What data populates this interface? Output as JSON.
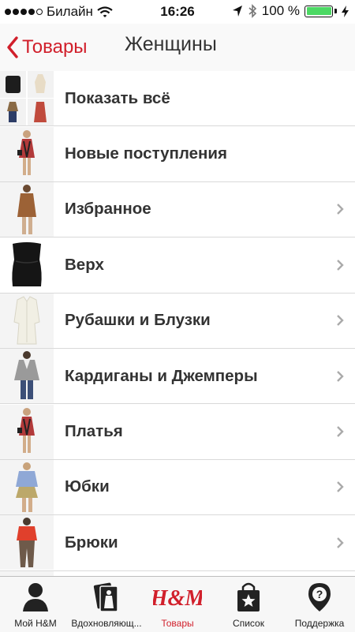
{
  "status_bar": {
    "carrier": "Билайн",
    "time": "16:26",
    "battery_text": "100 %"
  },
  "nav": {
    "back_label": "Товары",
    "title": "Женщины"
  },
  "list": [
    {
      "label": "Показать всё",
      "has_chevron": false,
      "thumb": "collage"
    },
    {
      "label": "Новые поступления",
      "has_chevron": false,
      "thumb": "dress-pattern"
    },
    {
      "label": "Избранное",
      "has_chevron": true,
      "thumb": "brown-top"
    },
    {
      "label": "Верх",
      "has_chevron": true,
      "thumb": "black-top"
    },
    {
      "label": "Рубашки и Блузки",
      "has_chevron": true,
      "thumb": "white-blouse"
    },
    {
      "label": "Кардиганы и Джемперы",
      "has_chevron": true,
      "thumb": "grey-cardigan"
    },
    {
      "label": "Платья",
      "has_chevron": true,
      "thumb": "dress-pattern"
    },
    {
      "label": "Юбки",
      "has_chevron": true,
      "thumb": "skirt"
    },
    {
      "label": "Брюки",
      "has_chevron": true,
      "thumb": "trousers"
    }
  ],
  "tabs": [
    {
      "label": "Мой H&M",
      "icon": "person-icon",
      "active": false
    },
    {
      "label": "Вдохновляющ...",
      "icon": "inspiration-cards-icon",
      "active": false
    },
    {
      "label": "Товары",
      "icon": "hm-logo-icon",
      "active": true
    },
    {
      "label": "Список",
      "icon": "shopping-bag-star-icon",
      "active": false
    },
    {
      "label": "Поддержка",
      "icon": "help-pin-icon",
      "active": false
    }
  ],
  "colors": {
    "accent": "#d11f2b",
    "battery": "#4cd964"
  }
}
